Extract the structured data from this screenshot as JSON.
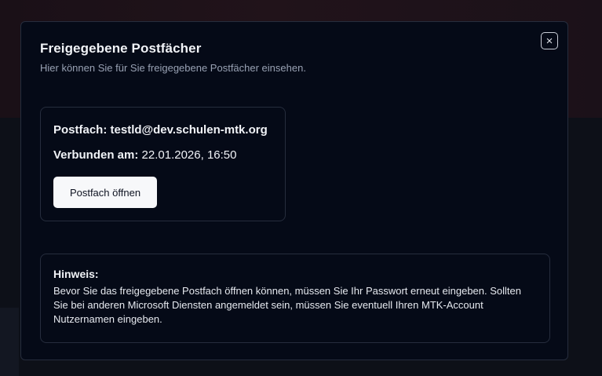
{
  "modal": {
    "title": "Freigegebene Postfächer",
    "subtitle": "Hier können Sie für Sie freigegebene Postfächer einsehen.",
    "close_icon": "close-x-icon"
  },
  "mailbox": {
    "label": "Postfach:",
    "address": "testld@dev.schulen-mtk.org",
    "connected_label": "Verbunden am:",
    "connected_value": "22.01.2026, 16:50",
    "open_button_label": "Postfach öffnen"
  },
  "hint": {
    "title": "Hinweis:",
    "text": "Bevor Sie das freigegebene Postfach öffnen können, müssen Sie Ihr Passwort erneut eingeben. Sollten Sie bei anderen Microsoft Diensten angemeldet sein, müssen Sie eventuell Ihren MTK-Account Nutzernamen eingeben."
  },
  "colors": {
    "modal_background": "#050a17",
    "border": "#262d3d",
    "text_primary": "#f1f3f7",
    "text_muted": "#98a1b3",
    "button_background": "#f7f8fa"
  }
}
